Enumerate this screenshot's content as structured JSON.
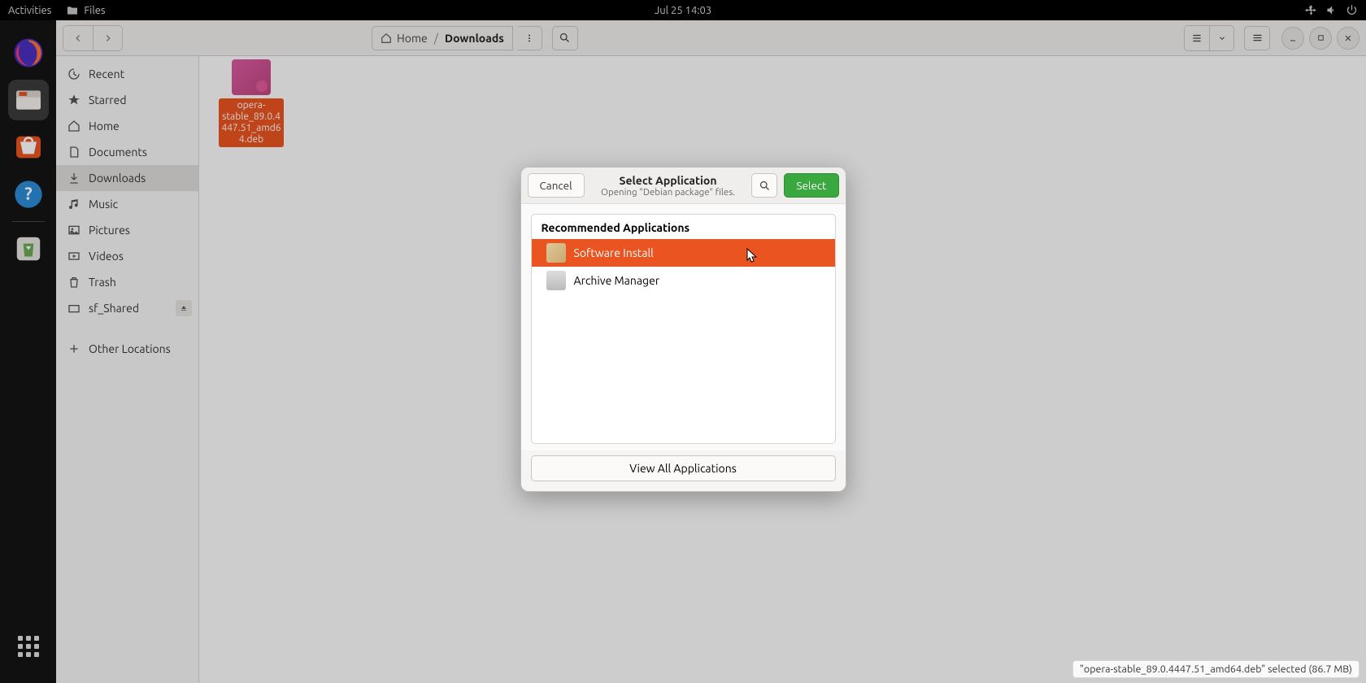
{
  "top_panel": {
    "activities": "Activities",
    "app_menu": "Files",
    "datetime": "Jul 25  14:03"
  },
  "headerbar": {
    "breadcrumb_home": "Home",
    "breadcrumb_current": "Downloads"
  },
  "sidebar": {
    "items": [
      {
        "label": "Recent"
      },
      {
        "label": "Starred"
      },
      {
        "label": "Home"
      },
      {
        "label": "Documents"
      },
      {
        "label": "Downloads"
      },
      {
        "label": "Music"
      },
      {
        "label": "Pictures"
      },
      {
        "label": "Videos"
      },
      {
        "label": "Trash"
      },
      {
        "label": "sf_Shared"
      },
      {
        "label": "Other Locations"
      }
    ]
  },
  "content": {
    "file_name": "opera-stable_89.0.4447.51_amd64.deb"
  },
  "dialog": {
    "cancel": "Cancel",
    "title": "Select Application",
    "subtitle": "Opening \"Debian package\" files.",
    "select": "Select",
    "heading": "Recommended Applications",
    "app1": "Software Install",
    "app2": "Archive Manager",
    "view_all": "View All Applications"
  },
  "statusbar": {
    "text": "\"opera-stable_89.0.4447.51_amd64.deb\" selected (86.7 MB)"
  }
}
